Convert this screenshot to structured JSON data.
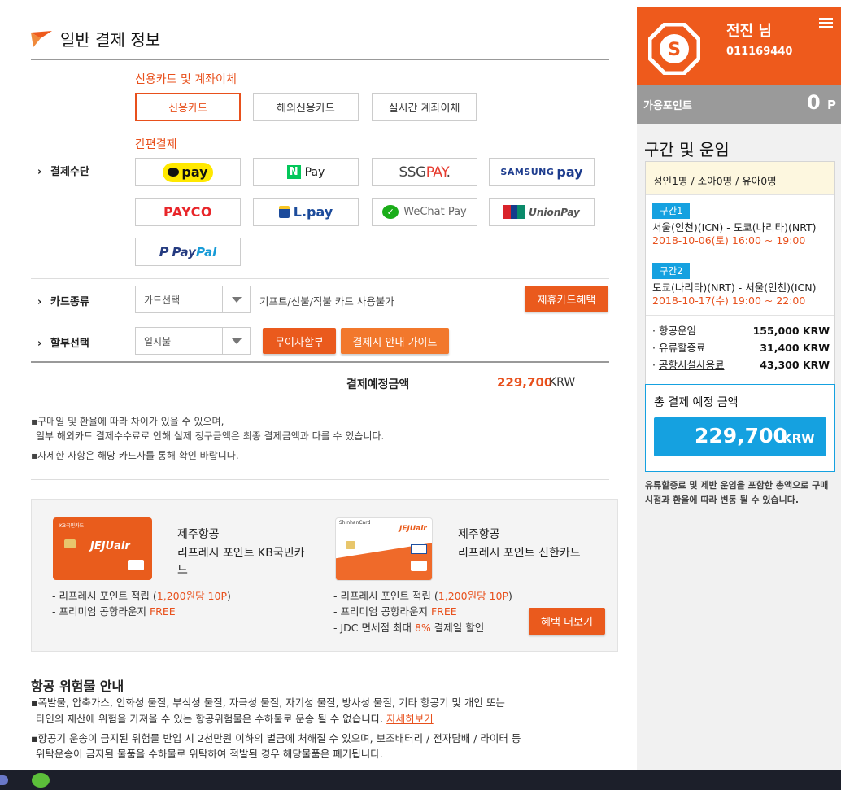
{
  "section": {
    "title": "일반 결제 정보"
  },
  "payment_method": {
    "label": "결제수단",
    "card_group_title": "신용카드 및 계좌이체",
    "card_options": [
      "신용카드",
      "해외신용카드",
      "실시간 계좌이체"
    ],
    "selected": "신용카드",
    "easy_group_title": "간편결제",
    "easy_options": [
      "kakao pay",
      "N Pay",
      "SSGPAY.",
      "SAMSUNG pay",
      "PAYCO",
      "L.pay",
      "WeChat Pay",
      "UnionPay",
      "PayPal"
    ]
  },
  "card_type": {
    "label": "카드종류",
    "placeholder": "카드선택",
    "notice": "기프트/선불/직불 카드 사용불가",
    "partner_button": "제휴카드혜택"
  },
  "installment": {
    "label": "할부선택",
    "value": "일시불",
    "no_interest_button": "무이자할부",
    "guide_button": "결제시 안내 가이드"
  },
  "expected": {
    "label": "결제예정금액",
    "amount": "229,700",
    "currency": "KRW"
  },
  "notes": [
    "구매일 및 환율에 따라 차이가 있을 수 있으며,",
    "일부 해외카드 결제수수료로 인해 실제 청구금액은 최종 결제금액과 다를 수 있습니다.",
    "자세한 사항은 해당 카드사를 통해 확인 바랍니다."
  ],
  "promo": {
    "card1": {
      "line1": "제주항공",
      "line2": "리프레시 포인트 KB국민카",
      "line3": "드",
      "brand": "JEJUair"
    },
    "card2": {
      "line1": "제주항공",
      "line2": "리프레시 포인트 신한카드",
      "brand": "JEJUair",
      "issuer": "ShinhanCard"
    },
    "benefits1": [
      {
        "pre": "- 리프레시 포인트 적립 (",
        "hl": "1,200원당 10P",
        "post": ")"
      },
      {
        "pre": "- 프리미엄 공항라운지 ",
        "hl": "FREE",
        "post": ""
      }
    ],
    "benefits2": [
      {
        "pre": "- 리프레시 포인트 적립 (",
        "hl": "1,200원당 10P",
        "post": ")"
      },
      {
        "pre": "- 프리미엄 공항라운지 ",
        "hl": "FREE",
        "post": ""
      },
      {
        "pre": "- JDC 면세점 최대 ",
        "hl": "8%",
        "post": " 결제일 할인"
      }
    ],
    "more_button": "혜택 더보기"
  },
  "dangerous_goods": {
    "title": "항공 위험물 안내",
    "line1": "폭발물, 압축가스, 인화성 물질, 부식성 물질, 자극성 물질, 자기성 물질, 방사성 물질, 기타 항공기 및 개인 또는",
    "line2": "타인의 재산에 위험을 가져올 수 있는 항공위험물은 수하물로 운송 될 수 없습니다.",
    "link": "자세히보기",
    "line3": "항공기 운송이 금지된 위험물 반입 시 2천만원 이하의 벌금에 처해질 수 있으며, 보조배터리 / 전자담배 / 라이터 등",
    "line4": "위탁운송이 금지된 물품을 수하물로 위탁하여 적발된 경우 해당물품은 폐기됩니다."
  },
  "sidebar": {
    "user_name": "전진 님",
    "user_id": "011169440",
    "points_label": "가용포인트",
    "points_value": "0",
    "points_unit": "P",
    "title": "구간 및 운임",
    "passengers": "성인1명 / 소아0명 / 유아0명",
    "segments": [
      {
        "badge": "구간1",
        "route": "서울(인천)(ICN) - 도쿄(나리타)(NRT)",
        "time": "2018-10-06(토) 16:00 ~ 19:00"
      },
      {
        "badge": "구간2",
        "route": "도쿄(나리타)(NRT) - 서울(인천)(ICN)",
        "time": "2018-10-17(수) 19:00 ~ 22:00"
      }
    ],
    "fares": [
      {
        "label": "항공운임",
        "value": "155,000 KRW"
      },
      {
        "label": "유류할증료",
        "value": "31,400 KRW"
      },
      {
        "label": "공항시설사용료",
        "value": "43,300 KRW"
      }
    ],
    "total_label": "총 결제 예정 금액",
    "total_value": "229,700",
    "total_currency": "KRW",
    "note": "유류할증료 및 제반 운임을 포함한 총액으로 구매시점과 환율에 따라 변동 될 수 있습니다."
  },
  "colors": {
    "accent": "#ee5a1c",
    "blue": "#15a1e0"
  }
}
